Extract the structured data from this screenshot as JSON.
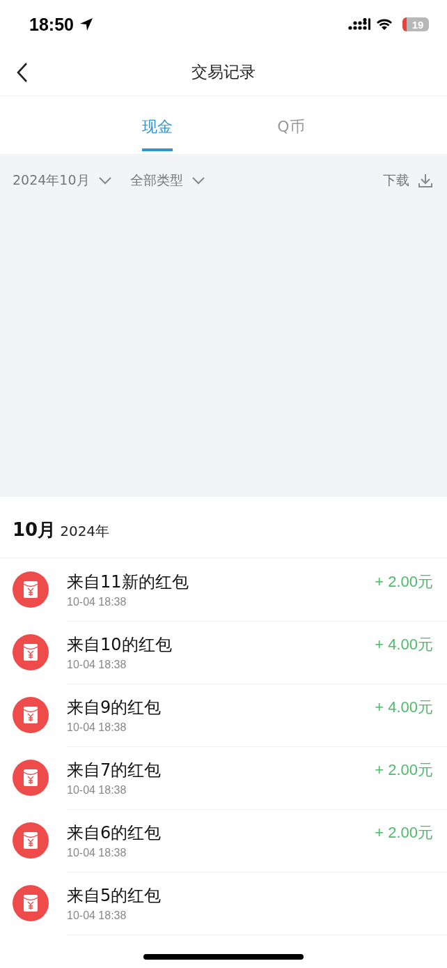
{
  "status_bar": {
    "time": "18:50",
    "battery": "19"
  },
  "nav": {
    "title": "交易记录"
  },
  "tabs": [
    {
      "label": "现金",
      "selected": true
    },
    {
      "label": "Q币",
      "selected": false
    }
  ],
  "filters": {
    "month": "2024年10月",
    "type": "全部类型",
    "download": "下载"
  },
  "section": {
    "month": "10月",
    "year": "2024年"
  },
  "records": [
    {
      "title": "来自11新的红包",
      "time": "10-04 18:38",
      "amount": "+ 2.00元"
    },
    {
      "title": "来自10的红包",
      "time": "10-04 18:38",
      "amount": "+ 4.00元"
    },
    {
      "title": "来自9的红包",
      "time": "10-04 18:38",
      "amount": "+ 4.00元"
    },
    {
      "title": "来自7的红包",
      "time": "10-04 18:38",
      "amount": "+ 2.00元"
    },
    {
      "title": "来自6的红包",
      "time": "10-04 18:38",
      "amount": "+ 2.00元"
    },
    {
      "title": "来自5的红包",
      "time": "10-04 18:38"
    }
  ]
}
